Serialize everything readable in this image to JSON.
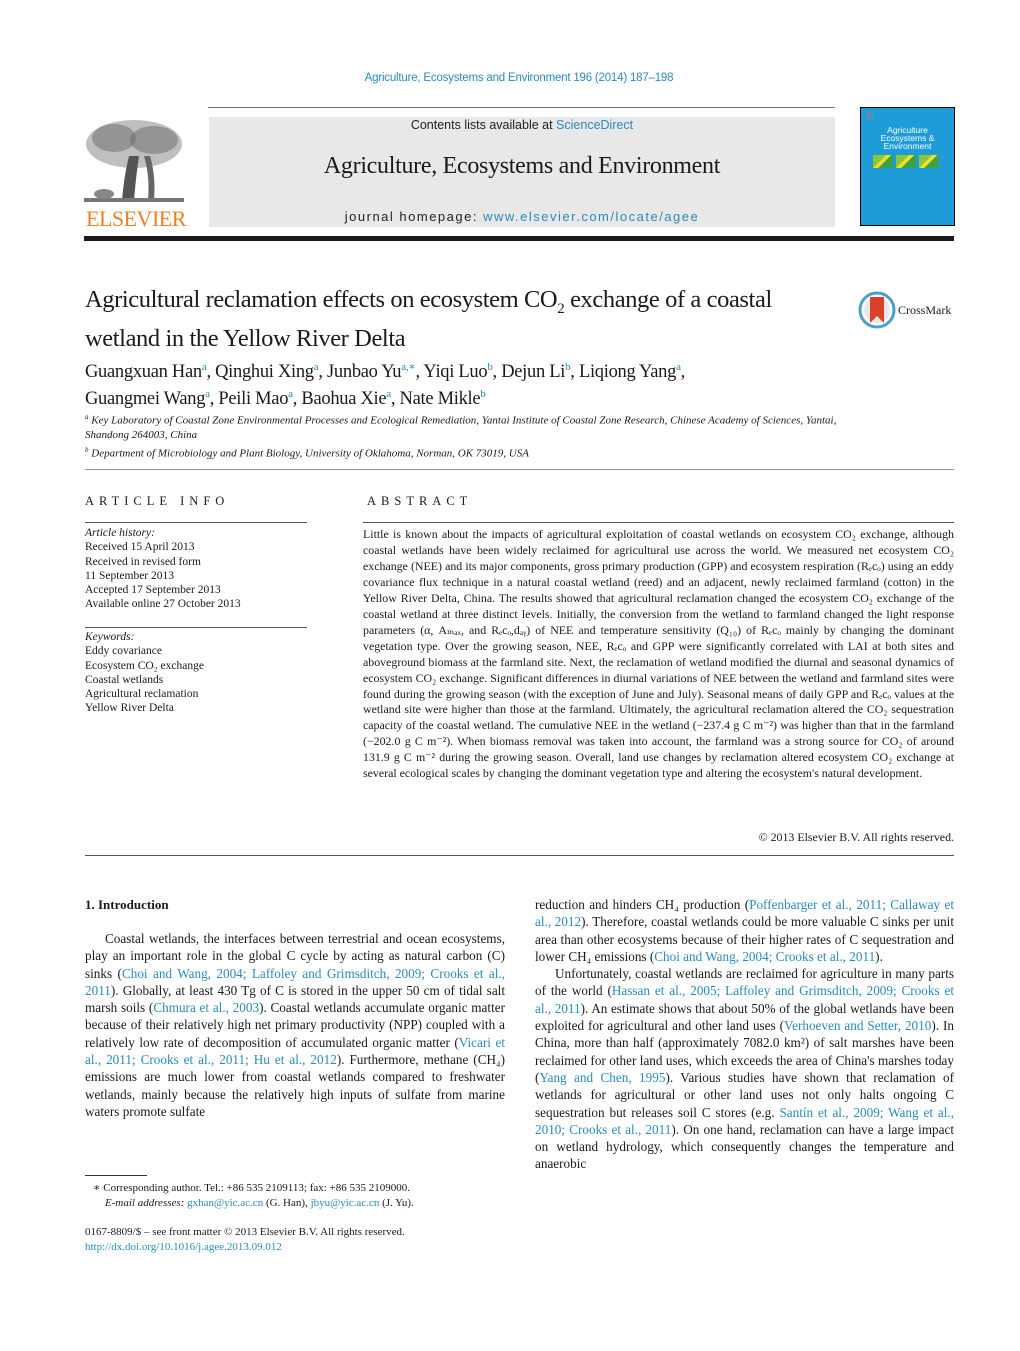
{
  "header": {
    "citation": "Agriculture, Ecosystems and Environment 196 (2014) 187–198",
    "publisher_logo_text": "ELSEVIER",
    "contents_prefix": "Contents lists available at ",
    "contents_link": "ScienceDirect",
    "journal_name": "Agriculture, Ecosystems and Environment",
    "homepage_prefix": "journal homepage: ",
    "homepage_link": "www.elsevier.com/locate/agee",
    "cover_title": "Agriculture Ecosystems & Environment",
    "crossmark_label": "CrossMark"
  },
  "article": {
    "title_part1": "Agricultural reclamation effects on ecosystem CO",
    "title_sub": "2",
    "title_part2": " exchange of a coastal wetland in the Yellow River Delta",
    "authors": [
      {
        "name": "Guangxuan Han",
        "aff": "a"
      },
      {
        "name": "Qinghui Xing",
        "aff": "a"
      },
      {
        "name": "Junbao Yu",
        "aff": "a,∗"
      },
      {
        "name": "Yiqi Luo",
        "aff": "b"
      },
      {
        "name": "Dejun Li",
        "aff": "b"
      },
      {
        "name": "Liqiong Yang",
        "aff": "a"
      },
      {
        "name": "Guangmei Wang",
        "aff": "a"
      },
      {
        "name": "Peili Mao",
        "aff": "a"
      },
      {
        "name": "Baohua Xie",
        "aff": "a"
      },
      {
        "name": "Nate Mikle",
        "aff": "b"
      }
    ],
    "affiliations": [
      {
        "mark": "a",
        "text": "Key Laboratory of Coastal Zone Environmental Processes and Ecological Remediation, Yantai Institute of Coastal Zone Research, Chinese Academy of Sciences, Yantai, Shandong 264003, China"
      },
      {
        "mark": "b",
        "text": "Department of Microbiology and Plant Biology, University of Oklahoma, Norman, OK 73019, USA"
      }
    ]
  },
  "article_info": {
    "heading": "ARTICLE INFO",
    "history_label": "Article history:",
    "history": [
      "Received 15 April 2013",
      "Received in revised form",
      "11 September 2013",
      "Accepted 17 September 2013",
      "Available online 27 October 2013"
    ],
    "keywords_label": "Keywords:",
    "keywords": [
      "Eddy covariance",
      "Ecosystem CO₂ exchange",
      "Coastal wetlands",
      "Agricultural reclamation",
      "Yellow River Delta"
    ]
  },
  "abstract": {
    "heading": "ABSTRACT",
    "text": "Little is known about the impacts of agricultural exploitation of coastal wetlands on ecosystem CO₂ exchange, although coastal wetlands have been widely reclaimed for agricultural use across the world. We measured net ecosystem CO₂ exchange (NEE) and its major components, gross primary production (GPP) and ecosystem respiration (Rₑcₒ) using an eddy covariance flux technique in a natural coastal wetland (reed) and an adjacent, newly reclaimed farmland (cotton) in the Yellow River Delta, China. The results showed that agricultural reclamation changed the ecosystem CO₂ exchange of the coastal wetland at three distinct levels. Initially, the conversion from the wetland to farmland changed the light response parameters (α, Aₘₐₓ, and Rₑcₒ,dₐᵧ) of NEE and temperature sensitivity (Q₁₀) of Rₑcₒ mainly by changing the dominant vegetation type. Over the growing season, NEE, Rₑcₒ and GPP were significantly correlated with LAI at both sites and aboveground biomass at the farmland site. Next, the reclamation of wetland modified the diurnal and seasonal dynamics of ecosystem CO₂ exchange. Significant differences in diurnal variations of NEE between the wetland and farmland sites were found during the growing season (with the exception of June and July). Seasonal means of daily GPP and Rₑcₒ values at the wetland site were higher than those at the farmland. Ultimately, the agricultural reclamation altered the CO₂ sequestration capacity of the coastal wetland. The cumulative NEE in the wetland (−237.4 g C m⁻²) was higher than that in the farmland (−202.0 g C m⁻²). When biomass removal was taken into account, the farmland was a strong source for CO₂ of around 131.9 g C m⁻² during the growing season. Overall, land use changes by reclamation altered ecosystem CO₂ exchange at several ecological scales by changing the dominant vegetation type and altering the ecosystem's natural development.",
    "copyright": "© 2013 Elsevier B.V. All rights reserved."
  },
  "body": {
    "section_heading": "1.  Introduction",
    "left_col": [
      {
        "t": "Coastal wetlands, the interfaces between terrestrial and ocean ecosystems, play an important role in the global C cycle by acting as natural carbon (C) sinks ("
      },
      {
        "l": "Choi and Wang, 2004; Laffoley and Grimsditch, 2009; Crooks et al., 2011"
      },
      {
        "t": "). Globally, at least 430 Tg of C is stored in the upper 50 cm of tidal salt marsh soils ("
      },
      {
        "l": "Chmura et al., 2003"
      },
      {
        "t": "). Coastal wetlands accumulate organic matter because of their relatively high net primary productivity (NPP) coupled with a relatively low rate of decomposition of accumulated organic matter ("
      },
      {
        "l": "Vicari et al., 2011; Crooks et al., 2011; Hu et al., 2012"
      },
      {
        "t": "). Furthermore, methane (CH₄) emissions are much lower from coastal wetlands compared to freshwater wetlands, mainly because the relatively high inputs of sulfate from marine waters promote sulfate"
      }
    ],
    "right_p1": [
      {
        "t": "reduction and hinders CH₄ production ("
      },
      {
        "l": "Poffenbarger et al., 2011; Callaway et al., 2012"
      },
      {
        "t": "). Therefore, coastal wetlands could be more valuable C sinks per unit area than other ecosystems because of their higher rates of C sequestration and lower CH₄ emissions ("
      },
      {
        "l": "Choi and Wang, 2004; Crooks et al., 2011"
      },
      {
        "t": ")."
      }
    ],
    "right_p2": [
      {
        "t": "Unfortunately, coastal wetlands are reclaimed for agriculture in many parts of the world ("
      },
      {
        "l": "Hassan et al., 2005; Laffoley and Grimsditch, 2009; Crooks et al., 2011"
      },
      {
        "t": "). An estimate shows that about 50% of the global wetlands have been exploited for agricultural and other land uses ("
      },
      {
        "l": "Verhoeven and Setter, 2010"
      },
      {
        "t": "). In China, more than half (approximately 7082.0 km²) of salt marshes have been reclaimed for other land uses, which exceeds the area of China's marshes today ("
      },
      {
        "l": "Yang and Chen, 1995"
      },
      {
        "t": "). Various studies have shown that reclamation of wetlands for agricultural or other land uses not only halts ongoing C sequestration but releases soil C stores (e.g. "
      },
      {
        "l": "Santín et al., 2009; Wang et al., 2010; Crooks et al., 2011"
      },
      {
        "t": "). On one hand, reclamation can have a large impact on wetland hydrology, which consequently changes the temperature and anaerobic"
      }
    ]
  },
  "footnote": {
    "corresponding": "∗  Corresponding author. Tel.: +86 535 2109113; fax: +86 535 2109000.",
    "email_label": "E-mail addresses: ",
    "email1": "gxhan@yic.ac.cn",
    "email1_who": " (G. Han), ",
    "email2": "jbyu@yic.ac.cn",
    "email2_who": " (J. Yu)."
  },
  "front_matter": {
    "issn_line": "0167-8809/$ – see front matter © 2013 Elsevier B.V. All rights reserved.",
    "doi": "http://dx.doi.org/10.1016/j.agee.2013.09.012"
  }
}
